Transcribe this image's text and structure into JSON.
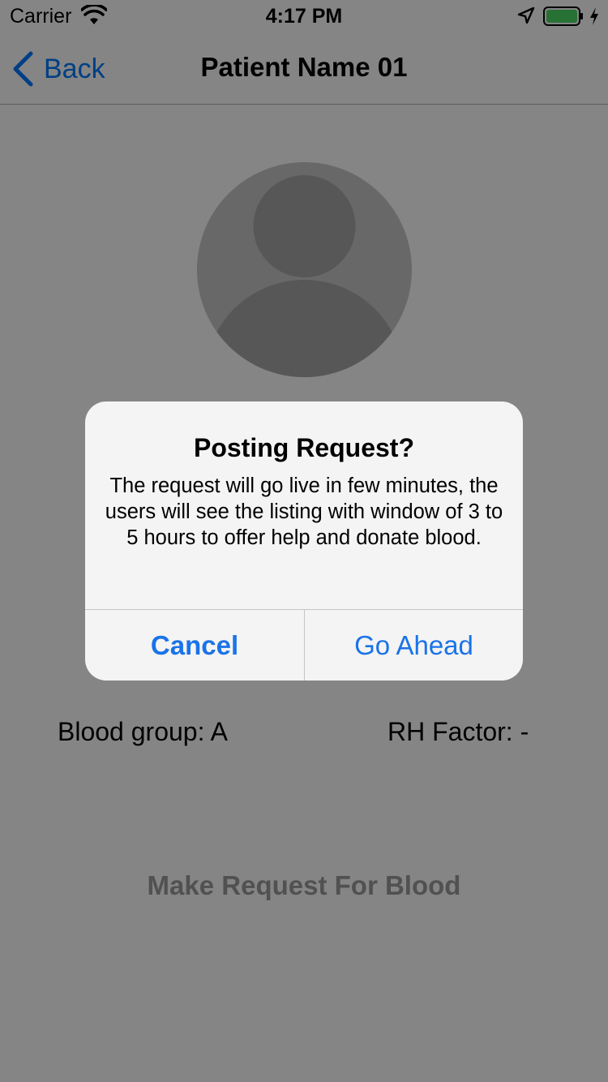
{
  "status_bar": {
    "carrier": "Carrier",
    "time": "4:17 PM",
    "battery_color": "#4cd964"
  },
  "nav": {
    "back_label": "Back",
    "title": "Patient Name 01"
  },
  "patient": {
    "blood_group": "Blood group: A",
    "rh_factor": "RH Factor: -"
  },
  "actions": {
    "request_label": "Make Request For Blood"
  },
  "alert": {
    "title": "Posting Request?",
    "message": "The request will go live in few minutes, the users will see the listing with window of 3 to 5 hours to offer help and donate blood.",
    "cancel_label": "Cancel",
    "confirm_label": "Go Ahead"
  },
  "colors": {
    "accent": "#1a73e8",
    "overlay": "rgba(0,0,0,0.48)"
  }
}
